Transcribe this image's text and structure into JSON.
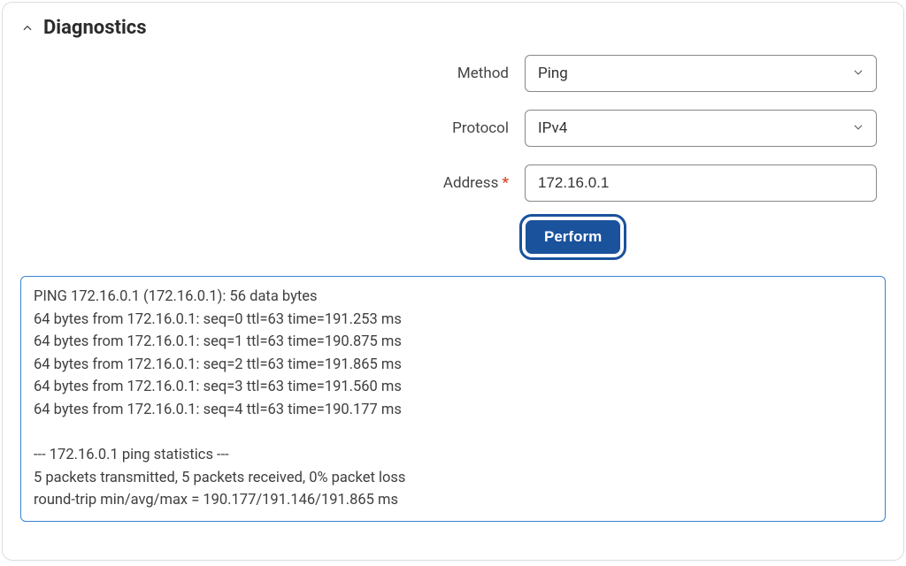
{
  "panel": {
    "title": "Diagnostics"
  },
  "form": {
    "method": {
      "label": "Method",
      "value": "Ping"
    },
    "protocol": {
      "label": "Protocol",
      "value": "IPv4"
    },
    "address": {
      "label": "Address",
      "required": "*",
      "value": "172.16.0.1"
    },
    "perform_label": "Perform"
  },
  "output": "PING 172.16.0.1 (172.16.0.1): 56 data bytes\n64 bytes from 172.16.0.1: seq=0 ttl=63 time=191.253 ms\n64 bytes from 172.16.0.1: seq=1 ttl=63 time=190.875 ms\n64 bytes from 172.16.0.1: seq=2 ttl=63 time=191.865 ms\n64 bytes from 172.16.0.1: seq=3 ttl=63 time=191.560 ms\n64 bytes from 172.16.0.1: seq=4 ttl=63 time=190.177 ms\n\n--- 172.16.0.1 ping statistics ---\n5 packets transmitted, 5 packets received, 0% packet loss\nround-trip min/avg/max = 190.177/191.146/191.865 ms"
}
